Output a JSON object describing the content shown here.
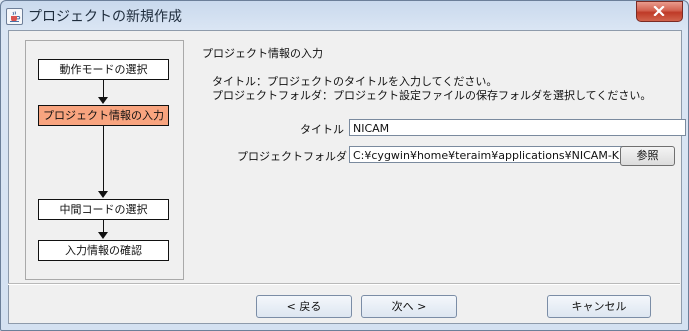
{
  "window": {
    "title": "プロジェクトの新規作成",
    "app_icon": "java-coffee-cup-icon",
    "close_icon": "close-icon"
  },
  "steps": [
    {
      "label": "動作モードの選択",
      "active": false
    },
    {
      "label": "プロジェクト情報の入力",
      "active": true
    },
    {
      "label": "中間コードの選択",
      "active": false
    },
    {
      "label": "入力情報の確認",
      "active": false
    }
  ],
  "main": {
    "section_title": "プロジェクト情報の入力",
    "desc_title": "タイトル：プロジェクトのタイトルを入力してください。",
    "desc_folder": "プロジェクトフォルダ：プロジェクト設定ファイルの保存フォルダを選択してください。",
    "title_label": "タイトル",
    "title_value": "NICAM",
    "folder_label": "プロジェクトフォルダ",
    "folder_value": "C:¥cygwin¥home¥teraim¥applications¥NICAM-K.KS",
    "browse_label": "参照"
  },
  "buttons": {
    "back": "< 戻る",
    "next": "次へ >",
    "cancel": "キャンセル"
  },
  "colors": {
    "active_step": "#f8a47f",
    "close_button": "#c9432e"
  }
}
